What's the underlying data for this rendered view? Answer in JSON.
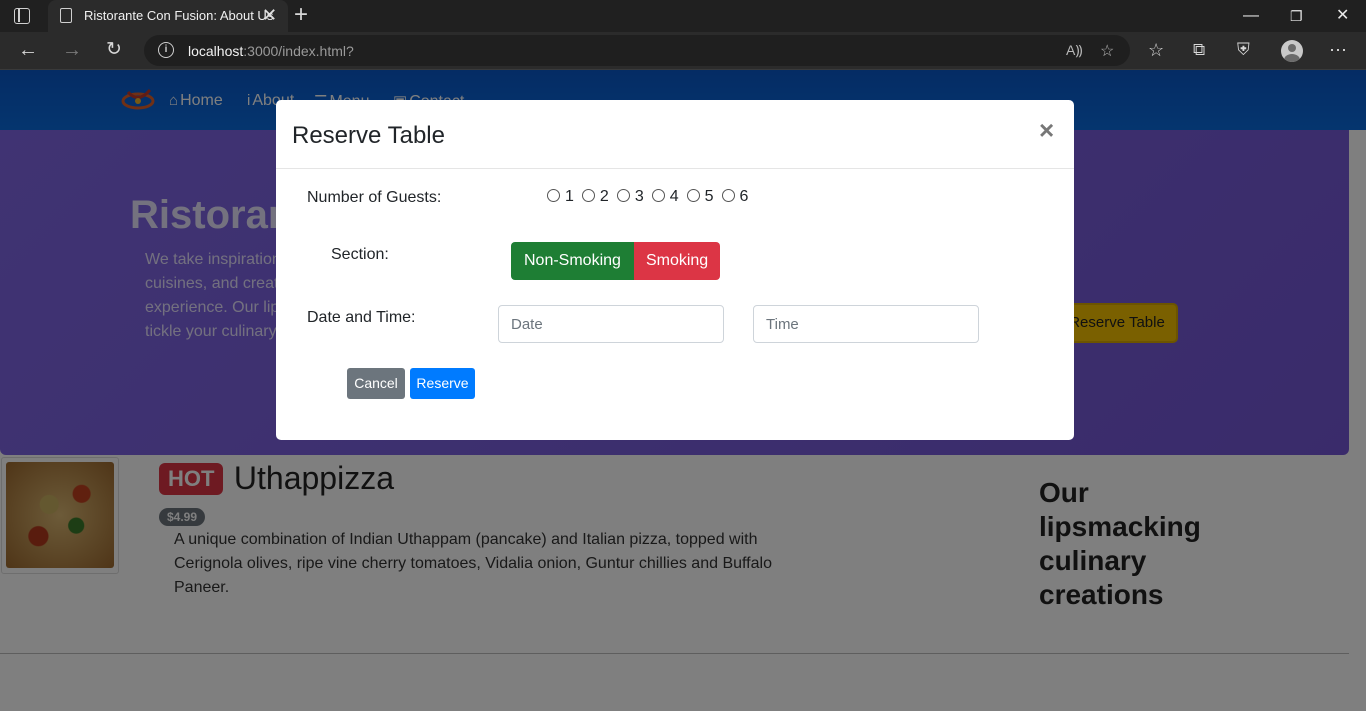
{
  "browser": {
    "tab_title": "Ristorante Con Fusion: About Us",
    "tab_close": "✕",
    "new_tab": "+",
    "url_host": "localhost",
    "url_rest": ":3000/index.html?",
    "icons": [
      "tab-actions-icon",
      "doc-icon",
      "back-icon",
      "forward-icon",
      "refresh-icon",
      "info-icon",
      "read-aloud-icon",
      "add-favorite-icon",
      "favorites-icon",
      "collections-icon",
      "browser-essentials-icon",
      "profile-icon",
      "more-icon"
    ]
  },
  "navbar": {
    "home": "Home",
    "about": "About",
    "menu": "Menu",
    "contact": "Contact"
  },
  "jumbotron": {
    "title": "Ristorante con Fusion",
    "text": "We take inspiration from the World's best cuisines, and create a unique fusion experience. Our lipsmacking creations will tickle your culinary senses!",
    "reserve_button": "Reserve Table"
  },
  "dish": {
    "badge": "HOT",
    "name": "Uthappizza",
    "price": "$4.99",
    "description": "A unique combination of Indian Uthappam (pancake) and Italian pizza, topped with Cerignola olives, ripe vine cherry tomatoes, Vidalia onion, Guntur chillies and Buffalo Paneer."
  },
  "sidebar": {
    "title": "Our lipsmacking culinary creations"
  },
  "modal": {
    "title": "Reserve Table",
    "close": "×",
    "guests_label": "Number of Guests:",
    "guest_options": [
      "1",
      "2",
      "3",
      "4",
      "5",
      "6"
    ],
    "section_label": "Section:",
    "section_non_smoking": "Non-Smoking",
    "section_smoking": "Smoking",
    "datetime_label": "Date and Time:",
    "date_placeholder": "Date",
    "time_placeholder": "Time",
    "cancel": "Cancel",
    "reserve": "Reserve"
  },
  "colors": {
    "navbar": "#0b6bde",
    "jumbotron": "#7b5fe0",
    "non_smoking": "#1e7e34",
    "smoking": "#dc3545",
    "reserve": "#007bff",
    "cancel": "#6c757d"
  }
}
